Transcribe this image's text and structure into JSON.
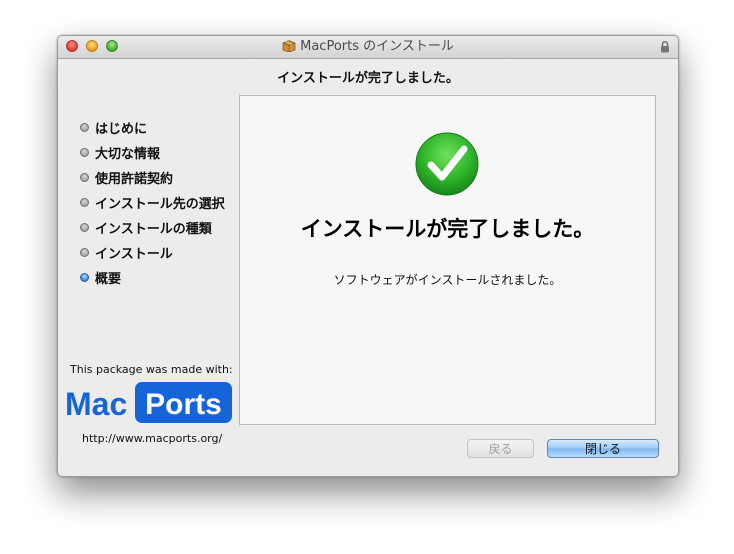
{
  "window": {
    "title": "MacPorts のインストール",
    "title_icon": "package-icon",
    "lock_icon": "lock-icon"
  },
  "header": {
    "title": "インストールが完了しました。"
  },
  "sidebar": {
    "steps": [
      {
        "label": "はじめに",
        "active": false
      },
      {
        "label": "大切な情報",
        "active": false
      },
      {
        "label": "使用許諾契約",
        "active": false
      },
      {
        "label": "インストール先の選択",
        "active": false
      },
      {
        "label": "インストールの種類",
        "active": false
      },
      {
        "label": "インストール",
        "active": false
      },
      {
        "label": "概要",
        "active": true
      }
    ],
    "made_with": "This package was made with:",
    "logo_left": "Mac",
    "logo_right": "Ports",
    "url": "http://www.macports.org/"
  },
  "main": {
    "icon": "checkmark-icon",
    "title": "インストールが完了しました。",
    "message": "ソフトウェアがインストールされました。"
  },
  "buttons": {
    "back": "戻る",
    "close": "閉じる"
  },
  "colors": {
    "accent_blue": "#1565d8",
    "check_green": "#2fb52a"
  }
}
